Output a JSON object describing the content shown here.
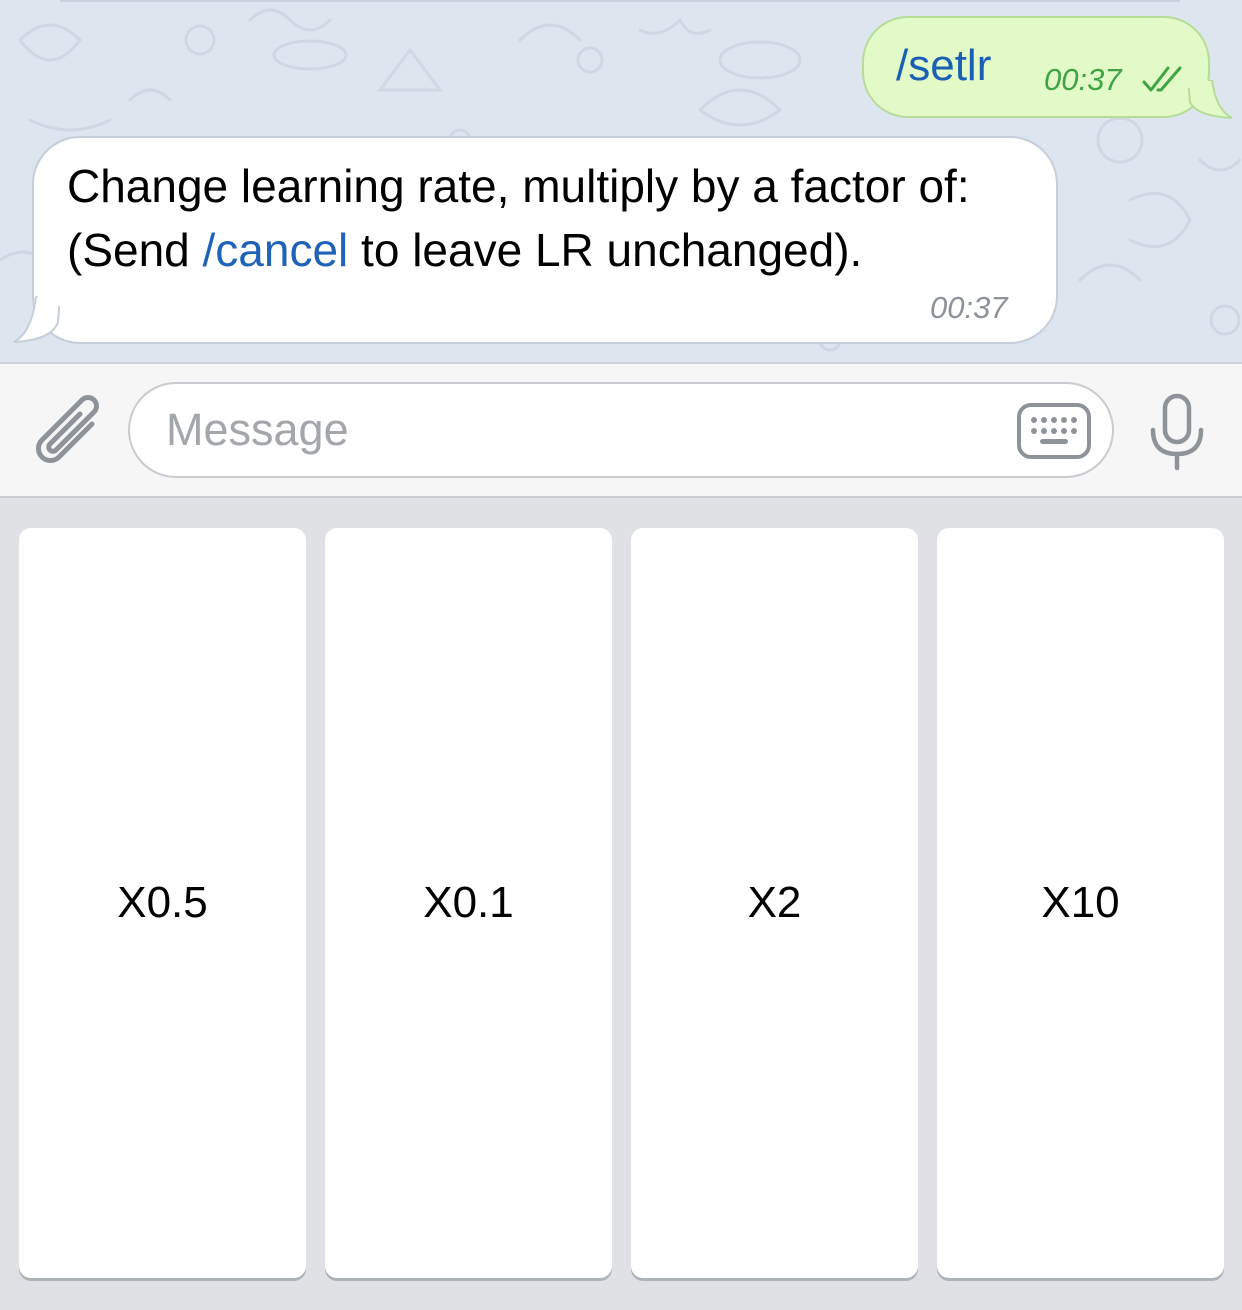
{
  "chat": {
    "outgoing": {
      "text": "/setlr",
      "time": "00:37",
      "status_icon": "double-check-icon"
    },
    "incoming": {
      "text_before": "Change learning rate, multiply by a factor of: (Send ",
      "command": "/cancel",
      "text_after": " to leave LR unchanged).",
      "time": "00:37"
    }
  },
  "input_bar": {
    "attach_icon": "paperclip-icon",
    "placeholder": "Message",
    "keyboard_icon": "keyboard-icon",
    "mic_icon": "microphone-icon"
  },
  "reply_keyboard": {
    "buttons": [
      {
        "label": "X0.5"
      },
      {
        "label": "X0.1"
      },
      {
        "label": "X2"
      },
      {
        "label": "X10"
      }
    ]
  },
  "colors": {
    "outgoing_bubble": "#e2f9c8",
    "link_blue": "#1f63b8",
    "time_green": "#3fa443"
  }
}
